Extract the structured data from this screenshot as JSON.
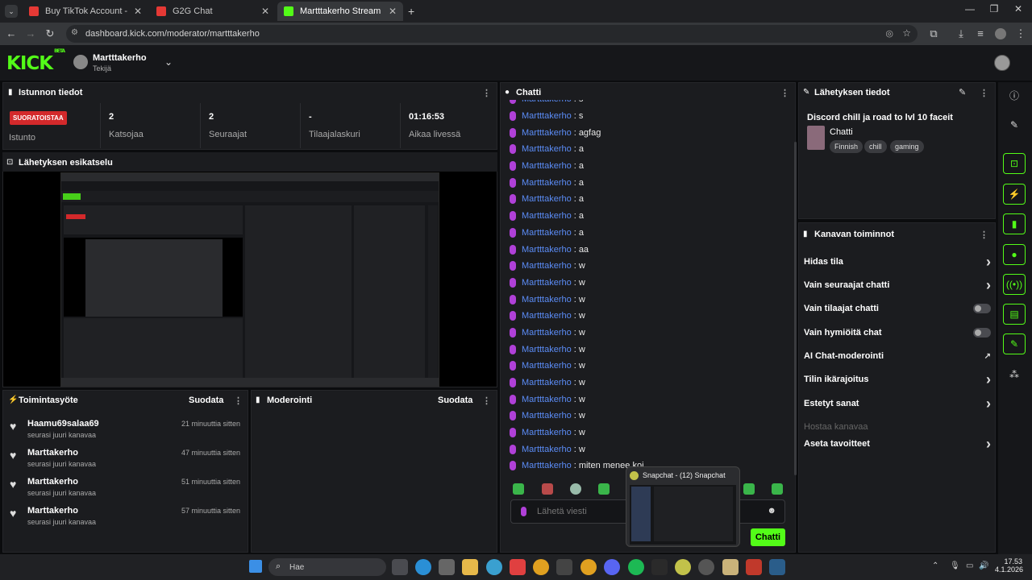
{
  "browser": {
    "tabs": [
      {
        "label": "Buy TikTok Account - Safe, Veri",
        "active": false
      },
      {
        "label": "G2G Chat",
        "active": false
      },
      {
        "label": "Martttakerho Stream - Kick Da",
        "active": true
      }
    ],
    "url": "dashboard.kick.com/moderator/martttakerho"
  },
  "header": {
    "logo": "KICK",
    "beta": "BETA",
    "channel_name": "Martttakerho",
    "role": "Tekijä"
  },
  "session": {
    "title": "Istunnon tiedot",
    "status_badge": "SUORATOISTAA",
    "status_label": "Istunto",
    "stats": [
      {
        "value": "2",
        "label": "Katsojaa"
      },
      {
        "value": "2",
        "label": "Seuraajat"
      },
      {
        "value": "-",
        "label": "Tilaajalaskuri"
      },
      {
        "value": "01:16:53",
        "label": "Aikaa livessä"
      }
    ]
  },
  "preview": {
    "title": "Lähetyksen esikatselu"
  },
  "activity": {
    "title": "Toimintasyöte",
    "filter": "Suodata",
    "items": [
      {
        "name": "Haamu69salaa69",
        "sub": "seurasi juuri kanavaa",
        "time": "21 minuuttia sitten"
      },
      {
        "name": "Marttakerho",
        "sub": "seurasi juuri kanavaa",
        "time": "47 minuuttia sitten"
      },
      {
        "name": "Marttakerho",
        "sub": "seurasi juuri kanavaa",
        "time": "51 minuuttia sitten"
      },
      {
        "name": "Marttakerho",
        "sub": "seurasi juuri kanavaa",
        "time": "57 minuuttia sitten"
      }
    ]
  },
  "moderation": {
    "title": "Moderointi",
    "filter": "Suodata"
  },
  "chat": {
    "title": "Chatti",
    "messages": [
      {
        "user": "Martttakerho",
        "text": "s"
      },
      {
        "user": "Martttakerho",
        "text": "s"
      },
      {
        "user": "Martttakerho",
        "text": "agfag"
      },
      {
        "user": "Martttakerho",
        "text": "a"
      },
      {
        "user": "Martttakerho",
        "text": "a"
      },
      {
        "user": "Martttakerho",
        "text": "a"
      },
      {
        "user": "Martttakerho",
        "text": "a"
      },
      {
        "user": "Martttakerho",
        "text": "a"
      },
      {
        "user": "Martttakerho",
        "text": "a"
      },
      {
        "user": "Martttakerho",
        "text": "aa"
      },
      {
        "user": "Martttakerho",
        "text": "w"
      },
      {
        "user": "Martttakerho",
        "text": "w"
      },
      {
        "user": "Martttakerho",
        "text": "w"
      },
      {
        "user": "Martttakerho",
        "text": "w"
      },
      {
        "user": "Martttakerho",
        "text": "w"
      },
      {
        "user": "Martttakerho",
        "text": "w"
      },
      {
        "user": "Martttakerho",
        "text": "w"
      },
      {
        "user": "Martttakerho",
        "text": "w"
      },
      {
        "user": "Martttakerho",
        "text": "w"
      },
      {
        "user": "Martttakerho",
        "text": "w"
      },
      {
        "user": "Martttakerho",
        "text": "w"
      },
      {
        "user": "Martttakerho",
        "text": "w"
      },
      {
        "user": "Martttakerho",
        "text": "miten menee koi"
      }
    ],
    "input_placeholder": "Lähetä viesti",
    "send_button": "Chatti"
  },
  "stream_info": {
    "title": "Lähetyksen tiedot",
    "stream_title": "Discord chill ja road to lvl 10 faceit",
    "category": "Chatti",
    "tags": [
      "Finnish",
      "chill",
      "gaming"
    ]
  },
  "channel_actions": {
    "title": "Kanavan toiminnot",
    "items": [
      {
        "label": "Hidas tila",
        "control": "chevron"
      },
      {
        "label": "Vain seuraajat chatti",
        "control": "chevron"
      },
      {
        "label": "Vain tilaajat chatti",
        "control": "toggle"
      },
      {
        "label": "Vain hymiöitä chat",
        "control": "toggle"
      },
      {
        "label": "AI Chat-moderointi",
        "control": "external"
      },
      {
        "label": "Tilin ikärajoitus",
        "control": "chevron"
      },
      {
        "label": "Estetyt sanat",
        "control": "chevron"
      },
      {
        "label": "Hostaa kanavaa",
        "control": "none",
        "disabled": true
      },
      {
        "label": "Aseta tavoitteet",
        "control": "chevron"
      }
    ]
  },
  "snapchat_popup": {
    "title": "Snapchat - (12) Snapchat"
  },
  "taskbar": {
    "search": "Hae",
    "time": "17.53",
    "date": "4.1.2026"
  },
  "colors": {
    "kick_green": "#53fc18",
    "live_red": "#d3292b",
    "username_blue": "#5b8cf7",
    "mic_purple": "#b040d8"
  }
}
